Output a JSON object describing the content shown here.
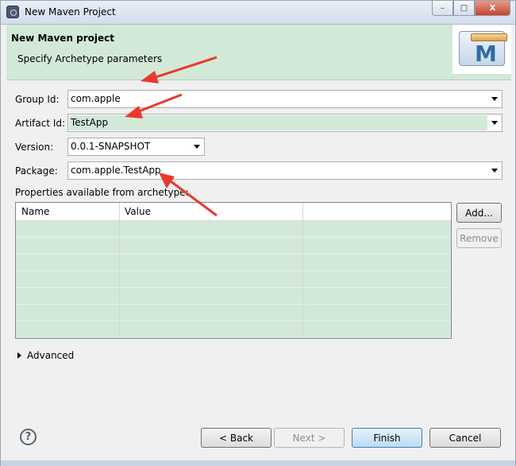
{
  "window": {
    "title": "New Maven Project"
  },
  "window_controls": {
    "minimize": "–",
    "maximize": "□",
    "close": "X"
  },
  "banner": {
    "title": "New Maven project",
    "subtitle": "Specify Archetype parameters",
    "logo_letter": "M"
  },
  "form": {
    "group_id": {
      "label": "Group Id:",
      "value": "com.apple"
    },
    "artifact_id": {
      "label": "Artifact Id:",
      "value": "TestApp"
    },
    "version": {
      "label": "Version:",
      "value": "0.0.1-SNAPSHOT"
    },
    "package": {
      "label": "Package:",
      "value": "com.apple.TestApp"
    }
  },
  "properties": {
    "label": "Properties available from archetype:",
    "columns": [
      "Name",
      "Value"
    ],
    "add_label": "Add...",
    "remove_label": "Remove"
  },
  "advanced": {
    "label": "Advanced"
  },
  "footer": {
    "help": "?",
    "back": "< Back",
    "next": "Next >",
    "finish": "Finish",
    "cancel": "Cancel"
  },
  "colors": {
    "banner_bg": "#d3e9d8",
    "annotation_arrow": "#e8392c"
  }
}
